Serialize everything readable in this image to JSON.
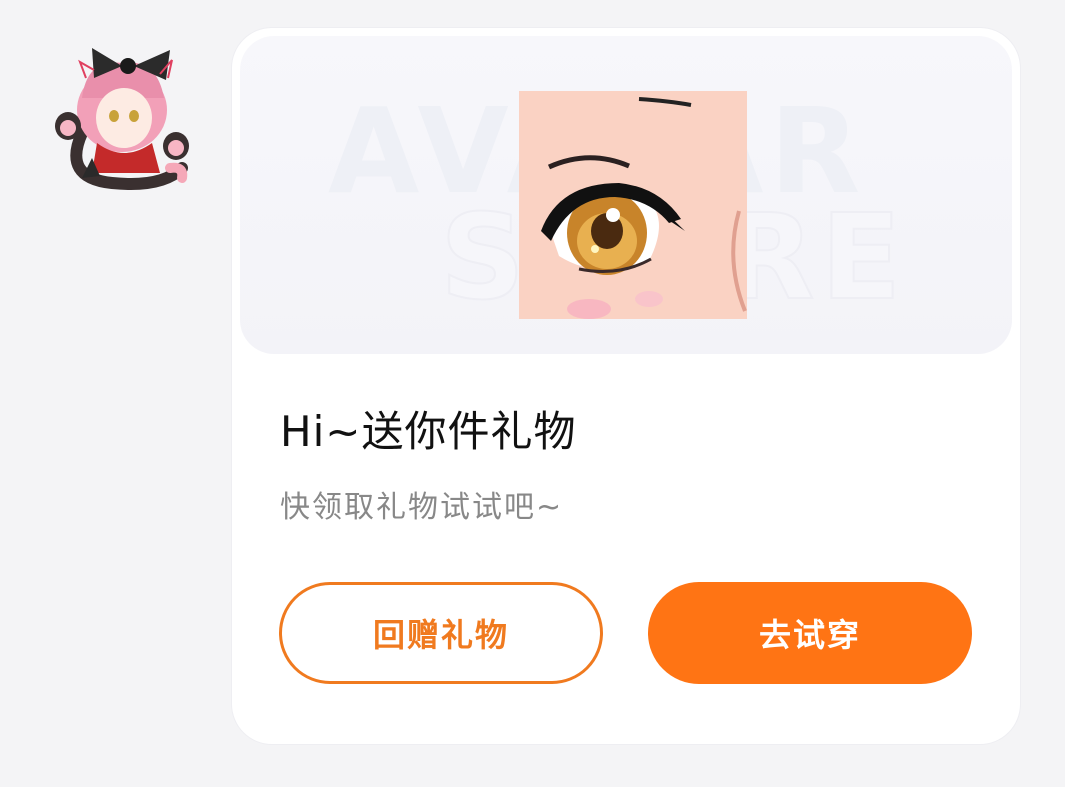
{
  "watermark": {
    "line1": "AVATAR",
    "line2": "STORE"
  },
  "card": {
    "title": "Hi~送你件礼物",
    "subtitle": "快领取礼物试试吧~"
  },
  "buttons": {
    "gift_back": "回赠礼物",
    "try_on": "去试穿"
  },
  "colors": {
    "accent": "#ff7414",
    "outline": "#f07a1f",
    "background": "#f4f4f6"
  }
}
